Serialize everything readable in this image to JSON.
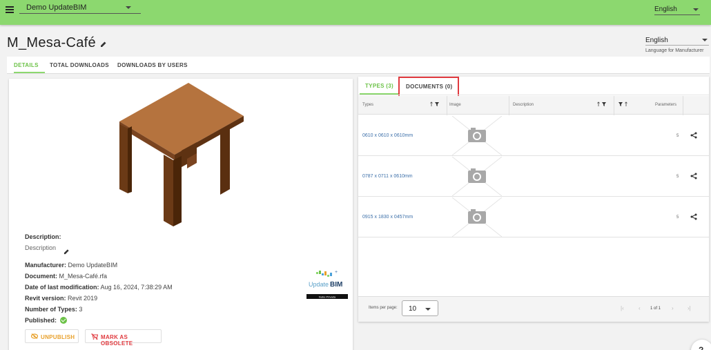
{
  "topbar": {
    "company": "Demo UpdateBIM",
    "language": "English"
  },
  "header": {
    "title": "M_Mesa-Café",
    "manufacturer_language": "English",
    "manufacturer_language_label": "Language for Manufacturer"
  },
  "tabs": [
    {
      "label": "DETAILS",
      "active": true
    },
    {
      "label": "TOTAL DOWNLOADS",
      "active": false
    },
    {
      "label": "DOWNLOADS BY USERS",
      "active": false
    }
  ],
  "details": {
    "description_label": "Description:",
    "description_value": "Description",
    "manufacturer_label": "Manufacturer:",
    "manufacturer_value": "Demo UpdateBIM",
    "document_label": "Document:",
    "document_value": "M_Mesa-Café.rfa",
    "modified_label": "Date of last modification:",
    "modified_value": "Aug 16, 2024, 7:38:29 AM",
    "revit_label": "Revit version:",
    "revit_value": "Revit 2019",
    "types_label": "Number of Types:",
    "types_value": "3",
    "published_label": "Published:",
    "unpublish_label": "UNPUBLISH",
    "obsolete_label": "MARK AS OBSOLETE",
    "logo_text_update": "Update",
    "logo_text_bim": "BIM",
    "logo_footer": "Nube Privada"
  },
  "types_panel": {
    "tab_types": "TYPES (3)",
    "tab_documents": "DOCUMENTS (0)",
    "columns": {
      "types": "Types",
      "image": "Image",
      "description": "Description",
      "parameters": "Parameters"
    },
    "rows": [
      {
        "type": "0610 x 0610 x 0610mm",
        "parameters": "5"
      },
      {
        "type": "0787 x 0711 x 0610mm",
        "parameters": "5"
      },
      {
        "type": "0915 x 1830 x 0457mm",
        "parameters": "5"
      }
    ],
    "items_per_page_label": "Items per page:",
    "items_per_page": "10",
    "page_text": "1 of 1"
  },
  "help_fab": "?",
  "colors": {
    "topbar": "#8cd86f",
    "accent": "#6cc247",
    "highlight": "#e0393e",
    "link": "#3a6ea8"
  },
  "icons": [
    "menu-icon",
    "pencil-icon",
    "check-circle-icon",
    "eye-off-icon",
    "cart-remove-icon",
    "camera-placeholder-icon",
    "share-icon",
    "filter-icon",
    "sort-arrow-icon",
    "first-page-icon",
    "prev-page-icon",
    "next-page-icon",
    "last-page-icon"
  ]
}
